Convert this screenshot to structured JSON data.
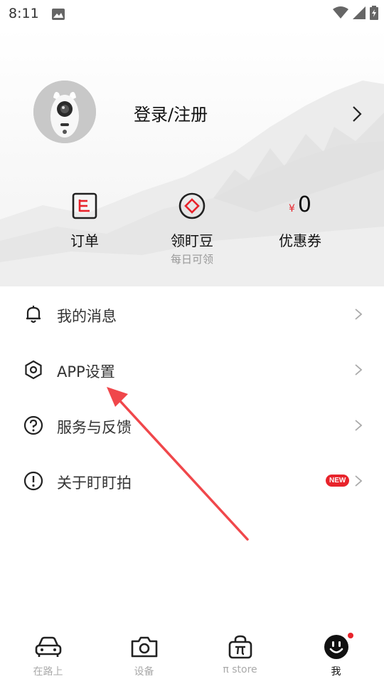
{
  "status_bar": {
    "time": "8:11"
  },
  "profile": {
    "login_label": "登录/注册"
  },
  "quick_actions": {
    "orders": {
      "label": "订单"
    },
    "beans": {
      "label": "领盯豆",
      "sub": "每日可领"
    },
    "coupons": {
      "label": "优惠券",
      "currency": "¥",
      "value": "0"
    }
  },
  "menu": [
    {
      "label": "我的消息"
    },
    {
      "label": "APP设置"
    },
    {
      "label": "服务与反馈"
    },
    {
      "label": "关于盯盯拍",
      "badge": "NEW"
    }
  ],
  "bottom_nav": [
    {
      "label": "在路上"
    },
    {
      "label": "设备"
    },
    {
      "label": "π store"
    },
    {
      "label": "我"
    }
  ],
  "colors": {
    "accent": "#e8232b",
    "annotation": "#f0474b"
  }
}
